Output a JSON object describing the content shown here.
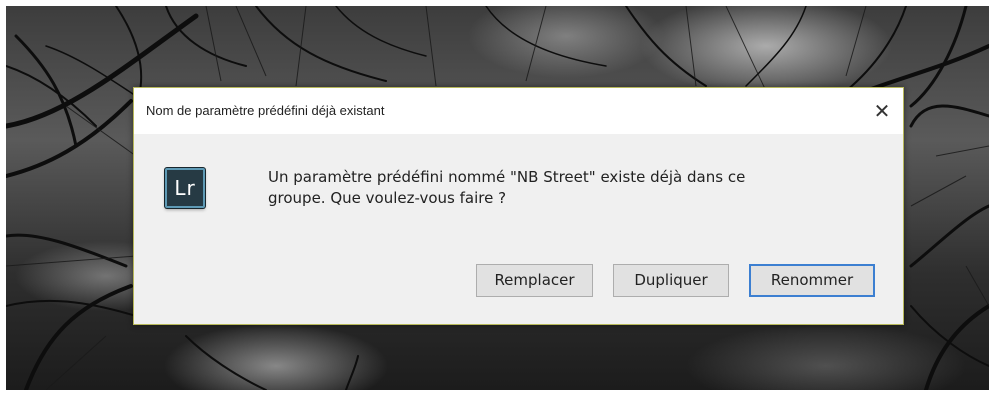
{
  "dialog": {
    "title": "Nom de paramètre prédéfini déjà existant",
    "close_glyph": "✕",
    "app_icon_label": "Lr",
    "message_line1": "Un paramètre prédéfini nommé \"NB Street\" existe déjà dans ce",
    "message_line2": "groupe. Que voulez-vous faire ?",
    "buttons": {
      "replace": "Remplacer",
      "duplicate": "Dupliquer",
      "rename": "Renommer"
    },
    "default_button": "rename"
  },
  "icons": {
    "close": "close-icon",
    "app": "lightroom-app-icon"
  },
  "colors": {
    "dialog_background": "#f0f0f0",
    "titlebar_background": "#ffffff",
    "focus_border": "#3c7fd1",
    "dialog_border": "#b7b85a",
    "app_icon_background": "#263a44",
    "app_icon_border": "#5e9ab5"
  }
}
